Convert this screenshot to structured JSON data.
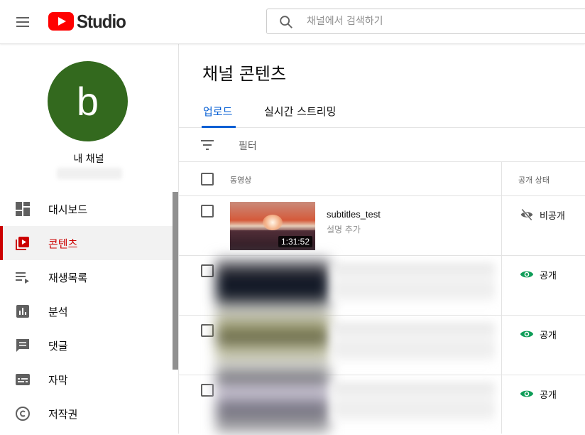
{
  "header": {
    "logo_text": "Studio",
    "search_placeholder": "채널에서 검색하기"
  },
  "sidebar": {
    "avatar_letter": "b",
    "channel_name": "내 채널",
    "items": [
      {
        "label": "대시보드",
        "icon": "dashboard-icon",
        "active": false
      },
      {
        "label": "콘텐츠",
        "icon": "content-icon",
        "active": true
      },
      {
        "label": "재생목록",
        "icon": "playlist-icon",
        "active": false
      },
      {
        "label": "분석",
        "icon": "analytics-icon",
        "active": false
      },
      {
        "label": "댓글",
        "icon": "comments-icon",
        "active": false
      },
      {
        "label": "자막",
        "icon": "subtitles-icon",
        "active": false
      },
      {
        "label": "저작권",
        "icon": "copyright-icon",
        "active": false
      }
    ]
  },
  "main": {
    "title": "채널 콘텐츠",
    "tabs": [
      {
        "label": "업로드",
        "active": true
      },
      {
        "label": "실시간 스트리밍",
        "active": false
      }
    ],
    "filter_label": "필터",
    "columns": {
      "video": "동영상",
      "visibility": "공개 상태"
    },
    "rows": [
      {
        "title": "subtitles_test",
        "description": "설명 추가",
        "duration": "1:31:52",
        "visibility": "비공개",
        "visibility_icon": "eye-off-icon"
      },
      {
        "title": "",
        "description": "",
        "duration": "",
        "visibility": "공개",
        "visibility_icon": "eye-icon"
      },
      {
        "title": "",
        "description": "",
        "duration": "",
        "visibility": "공개",
        "visibility_icon": "eye-icon"
      },
      {
        "title": "",
        "description": "",
        "duration": "",
        "visibility": "공개",
        "visibility_icon": "eye-icon"
      }
    ]
  },
  "colors": {
    "brand_red": "#ff0000",
    "active_red": "#cc0000",
    "tab_blue": "#065fd4",
    "public_green": "#0f9d58",
    "avatar_green": "#33691e"
  }
}
